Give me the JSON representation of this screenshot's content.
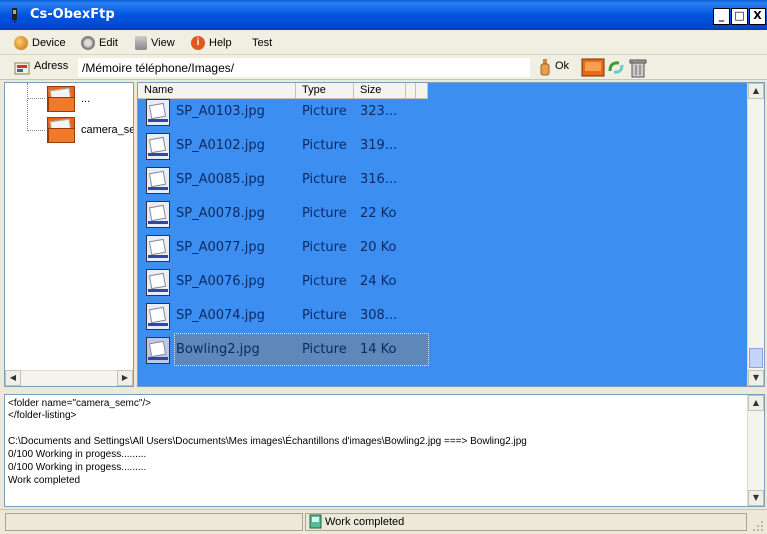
{
  "window": {
    "title": "Cs-ObexFtp",
    "buttons": {
      "minimize": "_",
      "maximize": "□",
      "close": "X"
    }
  },
  "menu": {
    "items": [
      {
        "label": "Device",
        "icon": "device-icon"
      },
      {
        "label": "Edit",
        "icon": "gear-icon"
      },
      {
        "label": "View",
        "icon": "view-icon"
      },
      {
        "label": "Help",
        "icon": "info-icon"
      },
      {
        "label": "Test",
        "icon": ""
      }
    ]
  },
  "address": {
    "label": "Adress",
    "value": "/Mémoire téléphone/Images/",
    "ok_label": "Ok"
  },
  "tree": {
    "nodes": [
      {
        "label": "..."
      },
      {
        "label": "camera_se"
      }
    ]
  },
  "filelist": {
    "columns": [
      "Name",
      "Type",
      "Size"
    ],
    "rows": [
      {
        "name": "SP_A0103.jpg",
        "type": "Picture",
        "size": "323..."
      },
      {
        "name": "SP_A0102.jpg",
        "type": "Picture",
        "size": "319..."
      },
      {
        "name": "SP_A0085.jpg",
        "type": "Picture",
        "size": "316..."
      },
      {
        "name": "SP_A0078.jpg",
        "type": "Picture",
        "size": "22 Ko"
      },
      {
        "name": "SP_A0077.jpg",
        "type": "Picture",
        "size": "20 Ko"
      },
      {
        "name": "SP_A0076.jpg",
        "type": "Picture",
        "size": "24 Ko"
      },
      {
        "name": "SP_A0074.jpg",
        "type": "Picture",
        "size": "308..."
      },
      {
        "name": "Bowling2.jpg",
        "type": "Picture",
        "size": "14 Ko"
      }
    ],
    "selected_index": 7
  },
  "log": {
    "lines": [
      "<folder name=\"camera_semc\"/>",
      "</folder-listing>",
      "",
      "C:\\Documents and Settings\\All Users\\Documents\\Mes images\\Échantillons d'images\\Bowling2.jpg ===> Bowling2.jpg",
      "0/100 Working in progess.........",
      "0/100 Working in progess.........",
      "Work completed"
    ]
  },
  "status": {
    "text": "Work completed"
  },
  "colors": {
    "titlebar": "#0055e0",
    "selection": "#3c8ff0",
    "chrome": "#ece9d8"
  }
}
